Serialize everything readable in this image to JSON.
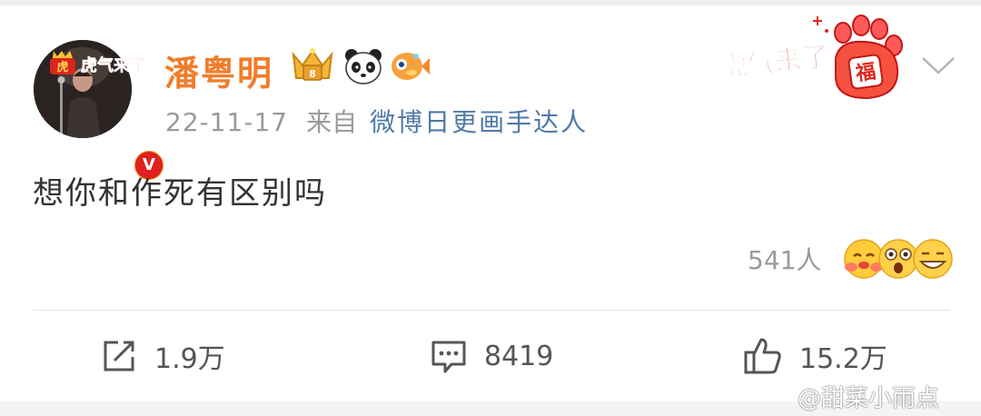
{
  "post": {
    "author": {
      "name": "潘粤明",
      "avatar_badge_text": "虎气来了"
    },
    "date": "22-11-17",
    "from_label": "来自",
    "source": "微博日更画手达人",
    "text": "想你和作死有区别吗",
    "tiger_banner": {
      "text": "虎气来了",
      "fu_text": "福"
    },
    "reactions": {
      "count_label": "541人",
      "emoji_names": [
        "hug-emoji",
        "shocked-emoji",
        "grin-emoji"
      ]
    }
  },
  "actions": {
    "repost_count": "1.9万",
    "comment_count": "8419",
    "like_count": "15.2万"
  },
  "watermark": "@甜菜小雨点",
  "colors": {
    "name": "#f07d2b",
    "source_link": "#4f79a8",
    "meta": "#9a9a9a",
    "body_text": "#333333",
    "verified": "#f29117"
  }
}
